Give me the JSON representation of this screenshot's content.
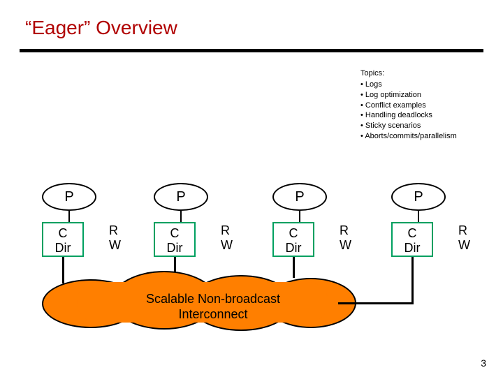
{
  "title": "“Eager” Overview",
  "topics": {
    "header": "Topics:",
    "items": [
      "Logs",
      "Log optimization",
      "Conflict examples",
      "Handling deadlocks",
      "Sticky scenarios",
      "Aborts/commits/parallelism"
    ]
  },
  "nodes": [
    {
      "p": "P",
      "c1": "C",
      "c2": "Dir",
      "rw": "R W"
    },
    {
      "p": "P",
      "c1": "C",
      "c2": "Dir",
      "rw": "R W"
    },
    {
      "p": "P",
      "c1": "C",
      "c2": "Dir",
      "rw": "R W"
    },
    {
      "p": "P",
      "c1": "C",
      "c2": "Dir",
      "rw": "R W"
    }
  ],
  "interconnect": {
    "line1": "Scalable Non-broadcast",
    "line2": "Interconnect"
  },
  "page_number": "3"
}
